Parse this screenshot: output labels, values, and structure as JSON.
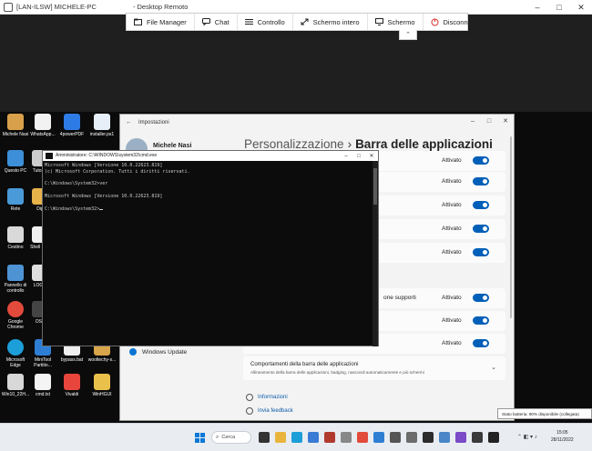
{
  "window": {
    "title": "[LAN-ILSW] MICHELE-PC",
    "subtitle": "- Desktop Remoto",
    "controls": [
      "–",
      "□",
      "✕"
    ]
  },
  "toolbar": {
    "items": [
      {
        "label": "File Manager",
        "icon": "file-manager-icon"
      },
      {
        "label": "Chat",
        "icon": "chat-icon"
      },
      {
        "label": "Controllo",
        "icon": "control-icon"
      },
      {
        "label": "Schermo intero",
        "icon": "fullscreen-icon"
      },
      {
        "label": "Schermo",
        "icon": "monitor-icon"
      },
      {
        "label": "Disconnetti",
        "icon": "disconnect-icon"
      }
    ],
    "collapse_glyph": "⌃"
  },
  "desktop": {
    "icons": [
      {
        "label": "Michele Nasi",
        "color": "#d8a04a"
      },
      {
        "label": "WhatsApp...",
        "color": "#f2f2f2"
      },
      {
        "label": "4powerPDF",
        "color": "#2d7be5"
      },
      {
        "label": "installer.ps1",
        "color": "#e6eef7"
      },
      {
        "label": "Questo PC",
        "color": "#3c8fd8"
      },
      {
        "label": "Tutorial",
        "color": "#cccccc"
      },
      {
        "label": "Rete",
        "color": "#4a9ad8"
      },
      {
        "label": "Dip",
        "color": "#e6b24a"
      },
      {
        "label": "Cestino",
        "color": "#d9d9d9"
      },
      {
        "label": "Shell Rep",
        "color": "#f0f0f0"
      },
      {
        "label": "Pannello di controllo",
        "color": "#4e94d4"
      },
      {
        "label": "LOGO",
        "color": "#e0e0e0"
      },
      {
        "label": "Google Chrome",
        "color": "#e24a3b"
      },
      {
        "label": "OSP",
        "color": "#444444"
      },
      {
        "label": "Microsoft Edge",
        "color": "#1c9ed8"
      },
      {
        "label": "MiniTool Partitio...",
        "color": "#2e7fd4"
      },
      {
        "label": "bypass.bat",
        "color": "#eeeeee"
      },
      {
        "label": "wooltechy-s...",
        "color": "#d9a54a"
      },
      {
        "label": "Win10_22H...",
        "color": "#d8d8d8"
      },
      {
        "label": "cmd.txt",
        "color": "#f4f4f4"
      },
      {
        "label": "Vivaldi",
        "color": "#e8463c"
      },
      {
        "label": "WinHGUI",
        "color": "#e9c04a"
      }
    ]
  },
  "settings": {
    "title": "Impostazioni",
    "back_glyph": "←",
    "user_name": "Michele Nasi",
    "breadcrumb_parent": "Personalizzazione",
    "breadcrumb_sep": "›",
    "breadcrumb_current": "Barra delle applicazioni",
    "rows": [
      {
        "label": "",
        "state": "Attivato"
      },
      {
        "label": "",
        "state": "Attivato"
      },
      {
        "label": "",
        "state": "Attivato"
      },
      {
        "label": "",
        "state": "Attivato"
      },
      {
        "label": "",
        "state": "Attivato"
      },
      {
        "label": "one supporti",
        "state": "Attivato"
      },
      {
        "label": "",
        "state": "Attivato"
      },
      {
        "label": "",
        "state": "Attivato"
      }
    ],
    "nav_windows_update": "Windows Update",
    "expander_title": "Comportamenti della barra delle applicazioni",
    "expander_desc": "Allineamento della barra delle applicazioni, badging, nascondi automaticamente e più schermi",
    "expander_chevron": "⌄",
    "link_info": "Informazioni",
    "link_feedback": "Invia feedback",
    "controls": [
      "–",
      "□",
      "✕"
    ]
  },
  "cmd": {
    "title": "Amministratore: C:\\WINDOWS\\system32\\cmd.exe",
    "lines": [
      "Microsoft Windows [Versione 10.0.22623.819]",
      "(c) Microsoft Corporation. Tutti i diritti riservati.",
      "",
      "C:\\Windows\\System32>ver",
      "",
      "Microsoft Windows [Versione 10.0.22623.819]",
      "",
      "C:\\Windows\\System32>"
    ],
    "controls": [
      "–",
      "□",
      "✕"
    ]
  },
  "taskbar": {
    "search_label": "Cerca",
    "search_glyph": "⌕",
    "battery_tooltip": "Stato batteria: 90% disponibile (collegata)",
    "time": "15:05",
    "date": "28/11/2022",
    "tray_glyphs": "⌃ ◧ ▾ ♪",
    "apps": [
      {
        "name": "taskview",
        "color": "#333333"
      },
      {
        "name": "explorer",
        "color": "#e9b43c"
      },
      {
        "name": "edge",
        "color": "#1c9ed8"
      },
      {
        "name": "store",
        "color": "#3a7bd5"
      },
      {
        "name": "app5",
        "color": "#b03a2e"
      },
      {
        "name": "app6",
        "color": "#888888"
      },
      {
        "name": "chrome",
        "color": "#e24a3b"
      },
      {
        "name": "app8",
        "color": "#2e7fd4"
      },
      {
        "name": "app9",
        "color": "#555555"
      },
      {
        "name": "app10",
        "color": "#6b6b6b"
      },
      {
        "name": "app11",
        "color": "#2c2c2c"
      },
      {
        "name": "app12",
        "color": "#4a86c8"
      },
      {
        "name": "app13",
        "color": "#7a4ac8"
      },
      {
        "name": "app14",
        "color": "#3a3a3a"
      },
      {
        "name": "app15",
        "color": "#222222"
      }
    ]
  }
}
